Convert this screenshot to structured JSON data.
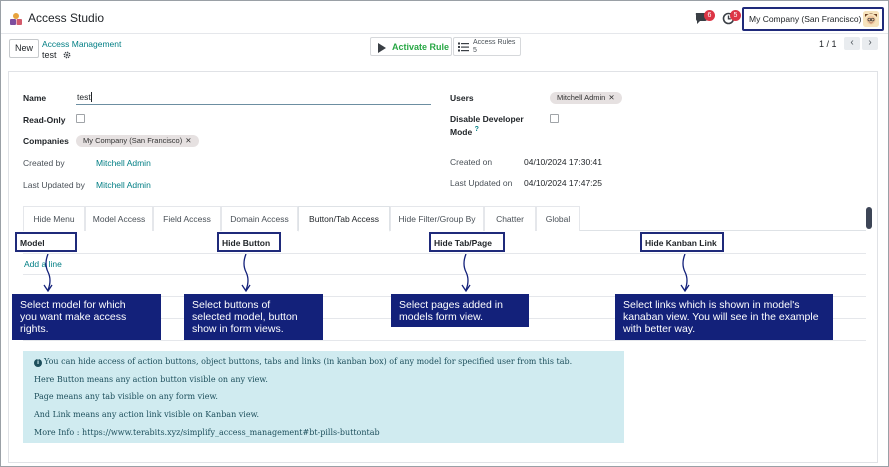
{
  "app": {
    "title": "Access Studio"
  },
  "navbar": {
    "chat_count": "6",
    "activity_count": "5",
    "company": "My Company (San Francisco)"
  },
  "control": {
    "new_label": "New",
    "breadcrumb_parent": "Access Management",
    "breadcrumb_current": "test",
    "activate_label": "Activate Rule",
    "rules_label": "Access Rules",
    "rules_count": "5",
    "pager": "1 / 1"
  },
  "form": {
    "name_label": "Name",
    "name_value": "test",
    "readonly_label": "Read-Only",
    "companies_label": "Companies",
    "company_tag": "My Company (San Francisco)",
    "created_by_label": "Created by",
    "created_by_value": "Mitchell Admin",
    "last_updated_by_label": "Last Updated by",
    "last_updated_by_value": "Mitchell Admin",
    "users_label": "Users",
    "user_tag": "Mitchell Admin",
    "dev_mode_label_1": "Disable Developer",
    "dev_mode_label_2": "Mode",
    "created_on_label": "Created on",
    "created_on_value": "04/10/2024 17:30:41",
    "last_updated_on_label": "Last Updated on",
    "last_updated_on_value": "04/10/2024 17:47:25"
  },
  "tabs": [
    {
      "label": "Hide Menu"
    },
    {
      "label": "Model Access"
    },
    {
      "label": "Field Access"
    },
    {
      "label": "Domain Access"
    },
    {
      "label": "Button/Tab Access",
      "active": true
    },
    {
      "label": "Hide Filter/Group By"
    },
    {
      "label": "Chatter"
    },
    {
      "label": "Global"
    }
  ],
  "table": {
    "columns": [
      "Model",
      "Hide Button",
      "Hide Tab/Page",
      "Hide Kanban Link"
    ],
    "add_line": "Add a line"
  },
  "callouts": [
    {
      "lines": [
        "Select model for which",
        "you want make access",
        "rights."
      ]
    },
    {
      "lines": [
        "Select buttons of",
        "selected model, button",
        "show in form views."
      ]
    },
    {
      "lines": [
        "Select pages added in",
        "models form view."
      ]
    },
    {
      "lines": [
        "Select links which is shown in model's",
        "kanaban view. You will see in the example",
        "with better way."
      ]
    }
  ],
  "info": {
    "line1": "You can hide access of action buttons, object buttons, tabs and links (in kanban box) of any model for specified user from this tab.",
    "line2": "Here Button means any action button visible on any view.",
    "line3": "Page means any tab visible on any form view.",
    "line4": "And Link means any action link visible on Kanban view.",
    "line5": "More Info : https://www.terabits.xyz/simplify_access_management#bt-pills-buttontab"
  },
  "colors": {
    "accent": "#017e84",
    "callout": "#13217a",
    "info_bg": "#d0ebf0",
    "activate": "#28a745"
  }
}
